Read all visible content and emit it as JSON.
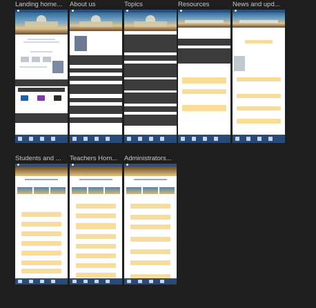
{
  "frames": [
    {
      "title": "Landing home..."
    },
    {
      "title": "About us"
    },
    {
      "title": "Topics"
    },
    {
      "title": "Resources"
    },
    {
      "title": "News and upd..."
    },
    {
      "title": "Students and ..."
    },
    {
      "title": "Teachers Hom..."
    },
    {
      "title": "Administrators..."
    }
  ],
  "colors": {
    "canvas": "#1e1e1e",
    "header": "#2f4f7a",
    "footer": "#294a76",
    "pill": "#f9dc97",
    "dark_band": "#3b3b3b"
  }
}
